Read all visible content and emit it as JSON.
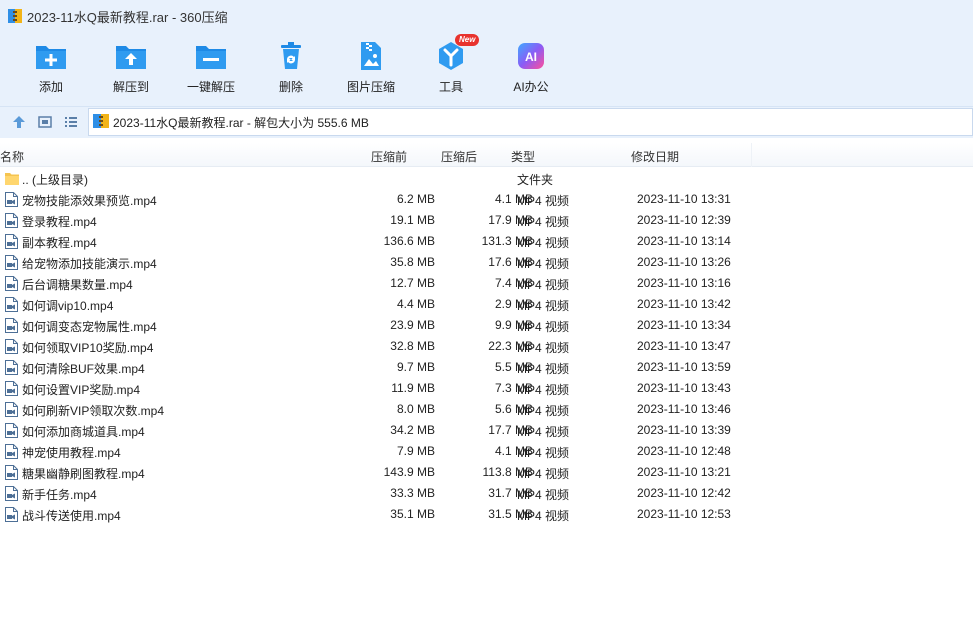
{
  "window": {
    "title": "2023-11水Q最新教程.rar - 360压缩"
  },
  "toolbar": {
    "buttons": [
      {
        "label": "添加",
        "icon": "add-icon"
      },
      {
        "label": "解压到",
        "icon": "extract-to-icon"
      },
      {
        "label": "一键解压",
        "icon": "one-click-extract-icon"
      },
      {
        "label": "删除",
        "icon": "delete-icon"
      },
      {
        "label": "图片压缩",
        "icon": "image-compress-icon"
      },
      {
        "label": "工具",
        "icon": "tools-icon",
        "badge": "New"
      },
      {
        "label": "AI办公",
        "icon": "ai-office-icon"
      }
    ]
  },
  "address": {
    "text": "2023-11水Q最新教程.rar - 解包大小为 555.6 MB"
  },
  "columns": {
    "name": "名称",
    "before": "压缩前",
    "after": "压缩后",
    "type": "类型",
    "modified": "修改日期"
  },
  "parent_row": {
    "name": ".. (上级目录)",
    "type": "文件夹"
  },
  "files": [
    {
      "name": "宠物技能添效果预览.mp4",
      "before": "6.2 MB",
      "after": "4.1 MB",
      "type": "MP4 视频",
      "modified": "2023-11-10 13:31"
    },
    {
      "name": "登录教程.mp4",
      "before": "19.1 MB",
      "after": "17.9 MB",
      "type": "MP4 视频",
      "modified": "2023-11-10 12:39"
    },
    {
      "name": "副本教程.mp4",
      "before": "136.6 MB",
      "after": "131.3 MB",
      "type": "MP4 视频",
      "modified": "2023-11-10 13:14"
    },
    {
      "name": "给宠物添加技能演示.mp4",
      "before": "35.8 MB",
      "after": "17.6 MB",
      "type": "MP4 视频",
      "modified": "2023-11-10 13:26"
    },
    {
      "name": "后台调糖果数量.mp4",
      "before": "12.7 MB",
      "after": "7.4 MB",
      "type": "MP4 视频",
      "modified": "2023-11-10 13:16"
    },
    {
      "name": "如何调vip10.mp4",
      "before": "4.4 MB",
      "after": "2.9 MB",
      "type": "MP4 视频",
      "modified": "2023-11-10 13:42"
    },
    {
      "name": "如何调变态宠物属性.mp4",
      "before": "23.9 MB",
      "after": "9.9 MB",
      "type": "MP4 视频",
      "modified": "2023-11-10 13:34"
    },
    {
      "name": "如何领取VIP10奖励.mp4",
      "before": "32.8 MB",
      "after": "22.3 MB",
      "type": "MP4 视频",
      "modified": "2023-11-10 13:47"
    },
    {
      "name": "如何清除BUF效果.mp4",
      "before": "9.7 MB",
      "after": "5.5 MB",
      "type": "MP4 视频",
      "modified": "2023-11-10 13:59"
    },
    {
      "name": "如何设置VIP奖励.mp4",
      "before": "11.9 MB",
      "after": "7.3 MB",
      "type": "MP4 视频",
      "modified": "2023-11-10 13:43"
    },
    {
      "name": "如何刷新VIP领取次数.mp4",
      "before": "8.0 MB",
      "after": "5.6 MB",
      "type": "MP4 视频",
      "modified": "2023-11-10 13:46"
    },
    {
      "name": "如何添加商城道具.mp4",
      "before": "34.2 MB",
      "after": "17.7 MB",
      "type": "MP4 视频",
      "modified": "2023-11-10 13:39"
    },
    {
      "name": "神宠使用教程.mp4",
      "before": "7.9 MB",
      "after": "4.1 MB",
      "type": "MP4 视频",
      "modified": "2023-11-10 12:48"
    },
    {
      "name": "糖果幽静刷图教程.mp4",
      "before": "143.9 MB",
      "after": "113.8 MB",
      "type": "MP4 视频",
      "modified": "2023-11-10 13:21"
    },
    {
      "name": "新手任务.mp4",
      "before": "33.3 MB",
      "after": "31.7 MB",
      "type": "MP4 视频",
      "modified": "2023-11-10 12:42"
    },
    {
      "name": "战斗传送使用.mp4",
      "before": "35.1 MB",
      "after": "31.5 MB",
      "type": "MP4 视频",
      "modified": "2023-11-10 12:53"
    }
  ],
  "colors": {
    "toolbar_bg": "#e8f1fc",
    "icon_blue": "#1e8ae6",
    "badge_red": "#e8332e"
  }
}
